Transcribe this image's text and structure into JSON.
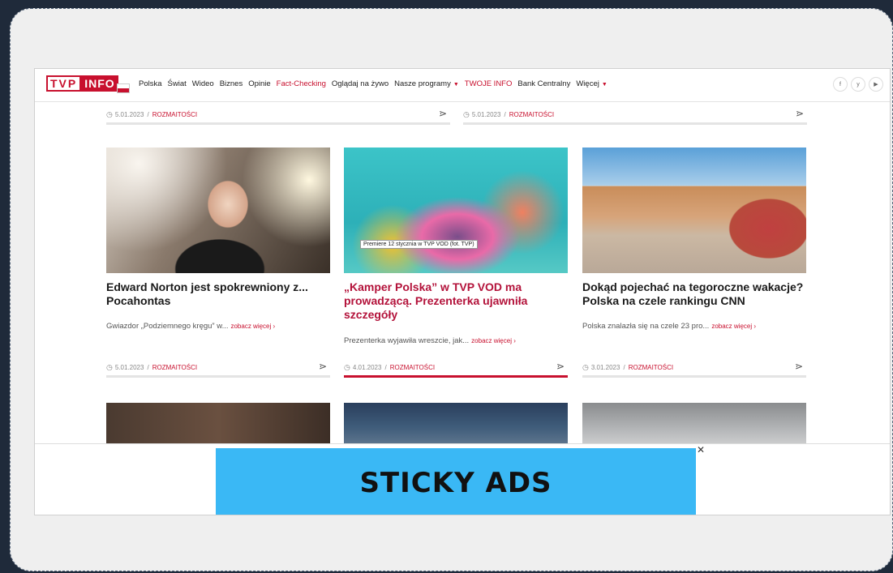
{
  "logo": {
    "tvp": "TVP",
    "info": "INFO"
  },
  "nav": [
    {
      "label": "Polska"
    },
    {
      "label": "Świat"
    },
    {
      "label": "Wideo"
    },
    {
      "label": "Biznes"
    },
    {
      "label": "Opinie"
    },
    {
      "label": "Fact-Checking"
    },
    {
      "label": "Oglądaj na żywo"
    },
    {
      "label": "Nasze programy"
    },
    {
      "label": "TWOJE INFO"
    },
    {
      "label": "Bank Centralny"
    },
    {
      "label": "Więcej"
    }
  ],
  "social": [
    "f",
    "y",
    "▶"
  ],
  "top_meta": [
    {
      "date": "5.01.2023",
      "category": "ROZMAITOŚCI"
    },
    {
      "date": "5.01.2023",
      "category": "ROZMAITOŚCI"
    }
  ],
  "articles": [
    {
      "title": "Edward Norton jest spokrewniony z... Pocahontas",
      "lead": "Gwiazdor „Podziemnego kręgu” w...",
      "more": "zobacz więcej ›",
      "date": "5.01.2023",
      "category": "ROZMAITOŚCI"
    },
    {
      "title": "„Kamper Polska” w TVP VOD ma prowadzącą. Prezenterka ujawniła szczegóły",
      "lead": "Prezenterka wyjawiła wreszcie, jak...",
      "more": "zobacz więcej ›",
      "date": "4.01.2023",
      "category": "ROZMAITOŚCI",
      "caption": "Premiere 12 stycznia w TVP VOD (fot. TVP)"
    },
    {
      "title": "Dokąd pojechać na tegoroczne wakacje? Polska na czele rankingu CNN",
      "lead": "Polska znalazła się na czele 23 pro...",
      "more": "zobacz więcej ›",
      "date": "3.01.2023",
      "category": "ROZMAITOŚCI"
    }
  ],
  "ad": {
    "label": "STICKY ADS",
    "close": "✕"
  }
}
